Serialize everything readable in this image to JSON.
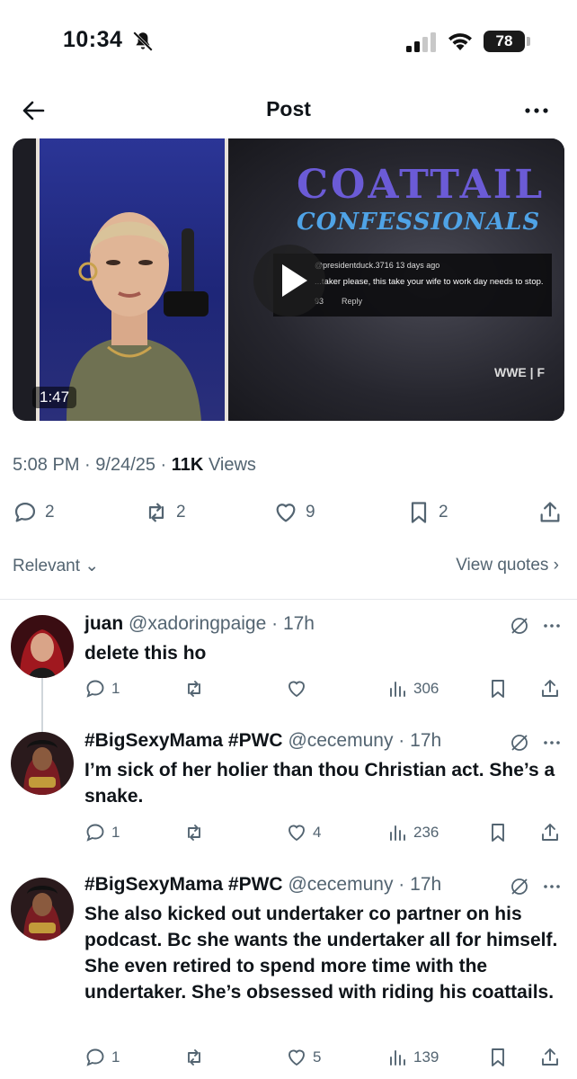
{
  "status_bar": {
    "time": "10:34",
    "battery": "78"
  },
  "header": {
    "title": "Post"
  },
  "video": {
    "duration": "1:47",
    "overlay_title_line1": "COATTAIL",
    "overlay_title_line2": "CONFESSIONALS",
    "overlay_comment_handle": "@presidentduck.3716 13 days ago",
    "overlay_comment_text": "...taker please, this take your wife to work day needs to stop.",
    "overlay_comment_likes": "93",
    "overlay_comment_reply": "Reply"
  },
  "post_meta": {
    "time": "5:08 PM",
    "date": "9/24/25",
    "views_count": "11K",
    "views_label": "Views"
  },
  "post_actions": {
    "replies": "2",
    "reposts": "2",
    "likes": "9",
    "bookmarks": "2"
  },
  "sort": {
    "relevant": "Relevant",
    "view_quotes": "View quotes"
  },
  "replies": [
    {
      "name": "juan",
      "handle": "@xadoringpaige",
      "time": "17h",
      "text": "delete this ho",
      "replies": "1",
      "reposts": "",
      "likes": "",
      "views": "306"
    },
    {
      "name": "#BigSexyMama #PWC",
      "handle": "@cecemuny",
      "time": "17h",
      "text": "I’m sick of her holier than thou  Christian act. She’s a snake.",
      "replies": "1",
      "reposts": "",
      "likes": "4",
      "views": "236"
    },
    {
      "name": "#BigSexyMama #PWC",
      "handle": "@cecemuny",
      "time": "17h",
      "text": "She also kicked out undertaker co partner on his podcast. Bc she wants the undertaker all for himself. She even retired to spend more time with the undertaker. She’s obsessed with riding his coattails.",
      "replies": "1",
      "reposts": "",
      "likes": "5",
      "views": "139"
    }
  ],
  "colors": {
    "text": "#0f1419",
    "secondary": "#536471",
    "divider": "#e5e8eb"
  }
}
